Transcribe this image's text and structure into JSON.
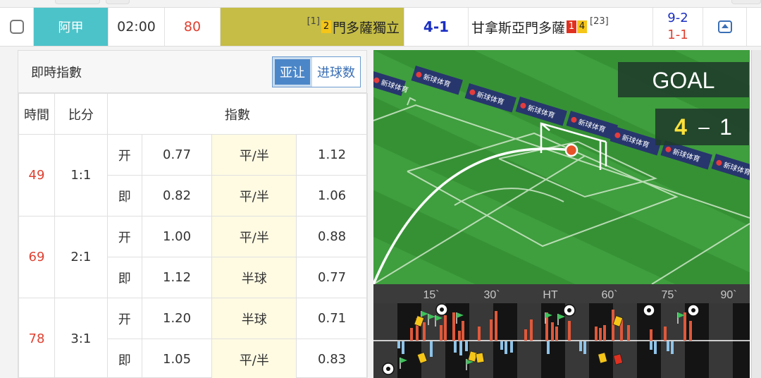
{
  "match": {
    "league": "阿甲",
    "kickoff": "02:00",
    "minute": "80",
    "home_rank": "[1]",
    "home_yellow": "2",
    "home_team": "門多薩獨立",
    "score": "4-1",
    "away_team": "甘拿斯亞門多薩",
    "away_red": "1",
    "away_yellow": "4",
    "away_rank": "[23]",
    "corners": "9-2",
    "half_time": "1-1"
  },
  "odds_panel": {
    "title": "即時指數",
    "toggle_active": "亚让",
    "toggle_inactive": "进球数",
    "headers": [
      "時間",
      "比分",
      "指數"
    ],
    "rows": [
      {
        "minute": "49",
        "score": "1:1",
        "open": {
          "label": "开",
          "home": "0.77",
          "line": "平/半",
          "away": "1.12"
        },
        "live": {
          "label": "即",
          "home": "0.82",
          "line": "平/半",
          "away": "1.06"
        }
      },
      {
        "minute": "69",
        "score": "2:1",
        "open": {
          "label": "开",
          "home": "1.00",
          "line": "平/半",
          "away": "0.88"
        },
        "live": {
          "label": "即",
          "home": "1.12",
          "line": "半球",
          "away": "0.77"
        }
      },
      {
        "minute": "78",
        "score": "3:1",
        "open": {
          "label": "开",
          "home": "1.20",
          "line": "半球",
          "away": "0.71"
        },
        "live": {
          "label": "即",
          "home": "1.05",
          "line": "平/半",
          "away": "0.83"
        }
      }
    ]
  },
  "live_view": {
    "event": "GOAL",
    "home_goals": "4",
    "separator": "–",
    "away_goals": "1",
    "ad_text": "新球体育",
    "timeline_ticks": [
      "15`",
      "30`",
      "HT",
      "60`",
      "75`",
      "90`"
    ]
  },
  "colors": {
    "league_bg": "#4cc3c9",
    "home_bg": "#c5bd46",
    "score_blue": "#1a2ec2",
    "alert_red": "#e04030",
    "pitch_green": "#3c9a3c",
    "home_bar": "#e0583a",
    "away_bar": "#8ec3e8",
    "goal_yellow": "#ffe23a"
  }
}
